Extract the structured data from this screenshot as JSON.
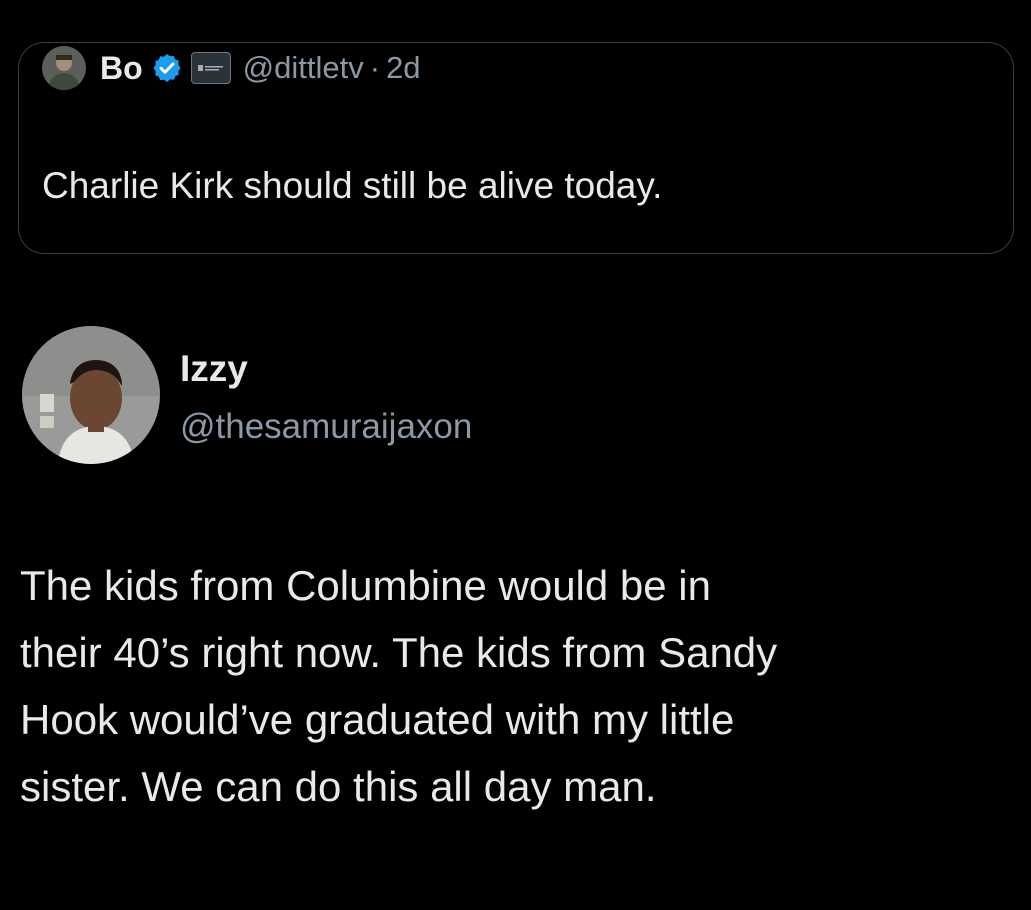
{
  "quoted_tweet": {
    "author_name": "Bo",
    "handle": "@dittletv",
    "separator": "·",
    "time": "2d",
    "text": "Charlie Kirk should still be alive today.",
    "icons": {
      "avatar": "profile-photo",
      "verified": "verified-badge-icon",
      "affiliation": "affiliation-badge-icon"
    },
    "colors": {
      "verified": "#1d9bf0",
      "handle": "#8b98a5",
      "border": "#3a3d40"
    }
  },
  "tweet": {
    "author_name": "Izzy",
    "handle": "@thesamuraijaxon",
    "lines": [
      "The kids from Columbine would be in",
      "their 40’s right now. The kids from Sandy",
      "Hook would’ve graduated with my little",
      "sister. We can do this all day man."
    ]
  },
  "theme": {
    "background": "#000000",
    "text": "#e7e9ea",
    "secondary_text": "#8b98a5"
  }
}
